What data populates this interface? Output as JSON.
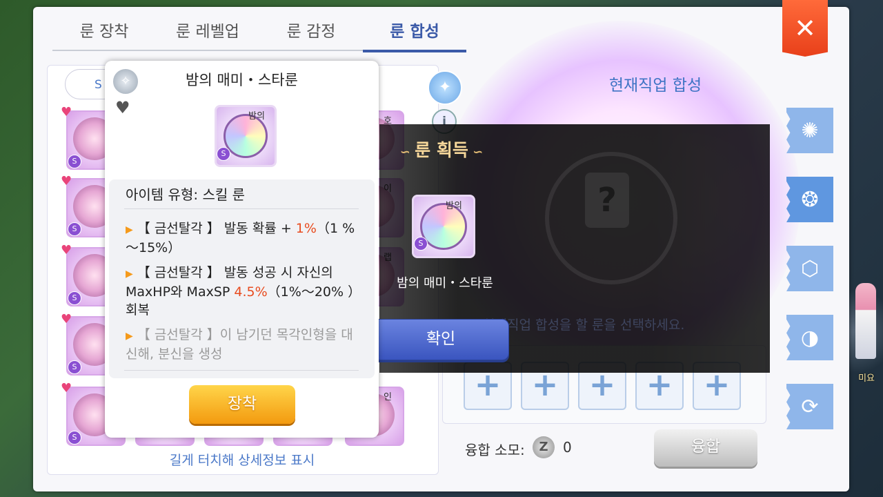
{
  "tabs": [
    {
      "label": "룬 장착"
    },
    {
      "label": "룬 레벨업"
    },
    {
      "label": "룬 감정"
    },
    {
      "label": "룬 합성"
    }
  ],
  "close_icon": "✕",
  "left": {
    "sort_label": "S",
    "hint": "길게 터치해 상세정보 표시",
    "rune_labels": {
      "r0": "호",
      "r1": "이",
      "r2": "랩",
      "r3": "인"
    }
  },
  "right": {
    "title": "현재직업 합성",
    "select_hint": "현재직업 합성을 할 룬을 선택하세요.",
    "cost_label": "융합 소모:",
    "cost_coin": "Z",
    "cost_value": "0",
    "fuse_label": "융합",
    "slot_plus": "+",
    "help_glyph": "i",
    "wand_glyph": "✦",
    "unknown_glyph": "?"
  },
  "tooltip": {
    "title": "밤의 매미・스타룬",
    "icon_label": "밤의",
    "type_line": "아이템 유형:  스킬 룬",
    "effect1_a": "【 금선탈각 】 발동 확률 + ",
    "effect1_hl": "1%",
    "effect1_b": "（1 %～15%）",
    "effect2_a": "【 금선탈각 】 발동 성공 시 자신의 MaxHP와 MaxSP ",
    "effect2_hl": "4.5%",
    "effect2_b": "（1%～20% ）회복",
    "effect3": "【 금선탈각 】이 남기던 목각인형을 대신해, 분신을 생성",
    "equip_label": "장착"
  },
  "acquire": {
    "title": "룬 획득",
    "icon_label": "밤의",
    "item_name": "밤의 매미・스타룬",
    "confirm_label": "확인"
  },
  "npc_name": "미요",
  "colors": {
    "accent_blue": "#3b5aa8",
    "highlight_orange": "#e84b1e",
    "equip_orange": "#f39a0f",
    "close_red": "#e8401a"
  }
}
